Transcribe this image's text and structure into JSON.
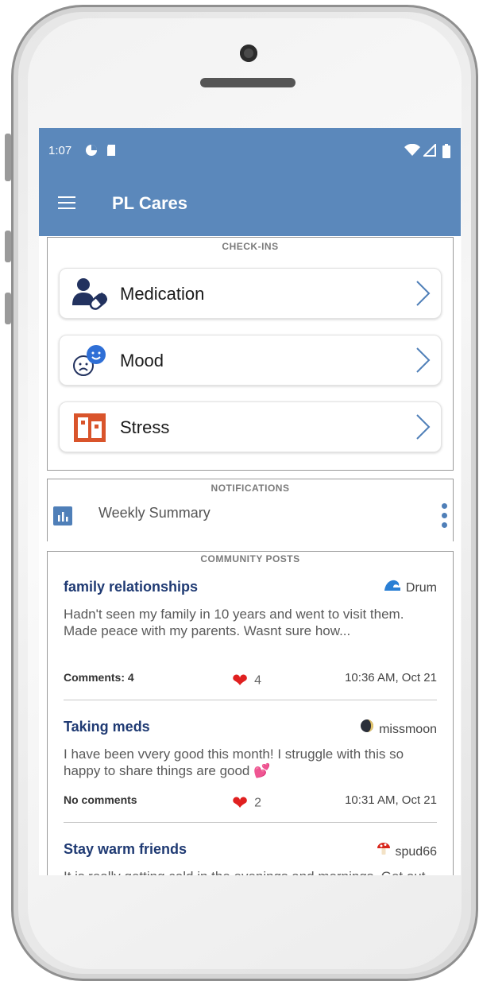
{
  "status_bar": {
    "time": "1:07",
    "left_icons": [
      "pie-chart-icon",
      "sd-card-icon"
    ],
    "right_icons": [
      "wifi-icon",
      "signal-icon",
      "battery-icon"
    ]
  },
  "app_bar": {
    "title": "PL Cares",
    "menu_icon": "hamburger-menu-icon"
  },
  "checkins": {
    "section_label": "CHECK-INS",
    "items": [
      {
        "label": "Medication",
        "icon": "medication-person-pill-icon"
      },
      {
        "label": "Mood",
        "icon": "mood-faces-icon"
      },
      {
        "label": "Stress",
        "icon": "stress-box-icon"
      }
    ]
  },
  "notifications": {
    "section_label": "NOTIFICATIONS",
    "item_label": "Weekly Summary",
    "icon": "bar-chart-icon"
  },
  "community": {
    "section_label": "COMMUNITY POSTS",
    "posts": [
      {
        "title": "family relationships",
        "author": "Drum",
        "author_icon": "wave-icon",
        "body": "Hadn't seen my family in 10 years and went to visit them. Made peace with my parents. Wasnt sure how...",
        "comments": "Comments: 4",
        "likes": "4",
        "time": "10:36 AM, Oct 21"
      },
      {
        "title": "Taking meds",
        "author": "missmoon",
        "author_icon": "moon-icon",
        "body": "I have been vvery good this month! I struggle with this so happy to share things are good 💕",
        "comments": "No comments",
        "likes": "2",
        "time": "10:31 AM, Oct 21"
      },
      {
        "title": "Stay warm friends",
        "author": "spud66",
        "author_icon": "mushroom-icon",
        "body": "It is really getting cold in the evenings and mornings. Get out your warm sweaters and hats!"
      }
    ]
  },
  "colors": {
    "app_bar": "#5b88bb",
    "post_title": "#1f3a73",
    "accent": "#4f7fb8",
    "heart": "#e02020",
    "stress_icon": "#d9542b"
  }
}
